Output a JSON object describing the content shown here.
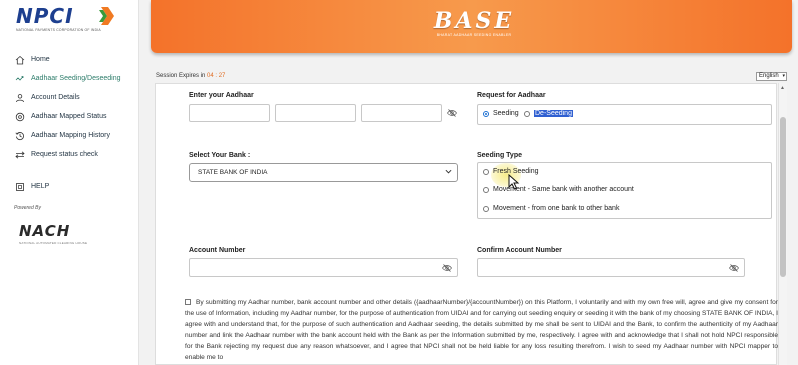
{
  "sidebar": {
    "logo_text": "NPCI",
    "logo_subtext": "NATIONAL PAYMENTS CORPORATION OF INDIA",
    "items": [
      {
        "label": "Home",
        "icon": "home-icon"
      },
      {
        "label": "Aadhaar Seeding/Deseeding",
        "icon": "aadhaar-seeding-icon"
      },
      {
        "label": "Account Details",
        "icon": "account-details-icon"
      },
      {
        "label": "Aadhaar Mapped Status",
        "icon": "mapped-status-icon"
      },
      {
        "label": "Aadhaar Mapping History",
        "icon": "history-icon"
      },
      {
        "label": "Request status check",
        "icon": "status-check-icon"
      },
      {
        "label": "HELP",
        "icon": "help-icon"
      }
    ],
    "powered_by": "Powered By",
    "nach_text": "NACH",
    "nach_subtext": "NATIONAL AUTOMATED CLEARING HOUSE"
  },
  "header": {
    "logo_text": "BASE",
    "logo_subtext": "BHARAT AADHAAR SEEDING ENABLER"
  },
  "session": {
    "label": "Session Expires in",
    "time": "04 : 27"
  },
  "language": {
    "selected": "English"
  },
  "form": {
    "aadhaar_label": "Enter your Aadhaar",
    "aadhaar_values": [
      "",
      "",
      ""
    ],
    "request_label": "Request for Aadhaar",
    "request_options": [
      "Seeding",
      "De-Seeding"
    ],
    "request_selected": "Seeding",
    "bank_label": "Select Your Bank :",
    "bank_selected": "STATE BANK OF INDIA",
    "seeding_type_label": "Seeding Type",
    "seeding_type_options": [
      "Fresh Seeding",
      "Movement - Same bank with another account",
      "Movement - from one bank to other bank"
    ],
    "account_label": "Account Number",
    "account_value": "",
    "confirm_account_label": "Confirm Account Number",
    "confirm_account_value": "",
    "consent_text": "By submitting my Aadhar number, bank account number and other details ({aadhaarNumber}/{accountNumber}) on this Platform, I voluntarily and with my own free will, agree and give my consent for the use of Information, including my Aadhar number, for the purpose of authentication from UIDAI and for carrying out seeding enquiry or seeding it with the bank of my choosing STATE BANK OF INDIA, I agree with and understand that, for the purpose of such authentication and Aadhaar seeding, the details submitted by me shall be sent to UIDAI and the Bank, to confirm the authenticity of my Aadhaar number and link the Aadhaar number with the bank account held with the Bank as per the Information submitted by me, respectively. I agree with and acknowledge that I shall not hold NPCI responsible for the Bank rejecting my request due any reason whatsoever, and I agree that NPCI shall not be held liable for any loss resulting therefrom. I wish to seed my Aadhaar number with NPCI mapper to enable me to"
  },
  "colors": {
    "banner_orange": "#f4722a",
    "npci_blue": "#1d3f8f",
    "active_green": "#2e7d6b",
    "session_time": "#e06a1f",
    "selection_highlight": "#2f5fd1"
  }
}
